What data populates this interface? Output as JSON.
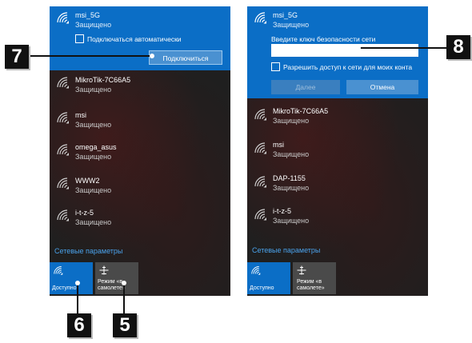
{
  "left_panel": {
    "networks": [
      {
        "ssid": "msi_5G",
        "status": "Защищено"
      },
      {
        "ssid": "MikroTik-7C66A5",
        "status": "Защищено"
      },
      {
        "ssid": "msi",
        "status": "Защищено"
      },
      {
        "ssid": "omega_asus",
        "status": "Защищено"
      },
      {
        "ssid": "WWW2",
        "status": "Защищено"
      },
      {
        "ssid": "i-t-z-5",
        "status": "Защищено"
      }
    ],
    "auto_connect_label": "Подключаться автоматически",
    "connect_button": "Подключиться",
    "network_settings_link": "Сетевые параметры",
    "tiles": {
      "wifi_label": "Доступно",
      "airplane_label_1": "Режим «в",
      "airplane_label_2": "самолете»"
    }
  },
  "right_panel": {
    "networks": [
      {
        "ssid": "msi_5G",
        "status": "Защищено"
      },
      {
        "ssid": "MikroTik-7C66A5",
        "status": "Защищено"
      },
      {
        "ssid": "msi",
        "status": "Защищено"
      },
      {
        "ssid": "DAP-1155",
        "status": "Защищено"
      },
      {
        "ssid": "i-t-z-5",
        "status": "Защищено"
      }
    ],
    "key_prompt": "Введите ключ безопасности сети",
    "key_value": "",
    "share_label": "Разрешить доступ к сети для моих конта",
    "next_button": "Далее",
    "cancel_button": "Отмена",
    "network_settings_link": "Сетевые параметры",
    "tiles": {
      "wifi_label": "Доступно",
      "airplane_label_1": "Режим «в",
      "airplane_label_2": "самолете»"
    }
  },
  "callouts": {
    "c5": "5",
    "c6": "6",
    "c7": "7",
    "c8": "8"
  },
  "colors": {
    "selected_bg": "#0b6ec6",
    "panel_bg": "#1f1f1f",
    "link": "#4aa3ec",
    "callout_bg": "#111111"
  },
  "icons": {
    "network": "wifi-icon",
    "airplane": "airplane-icon"
  }
}
